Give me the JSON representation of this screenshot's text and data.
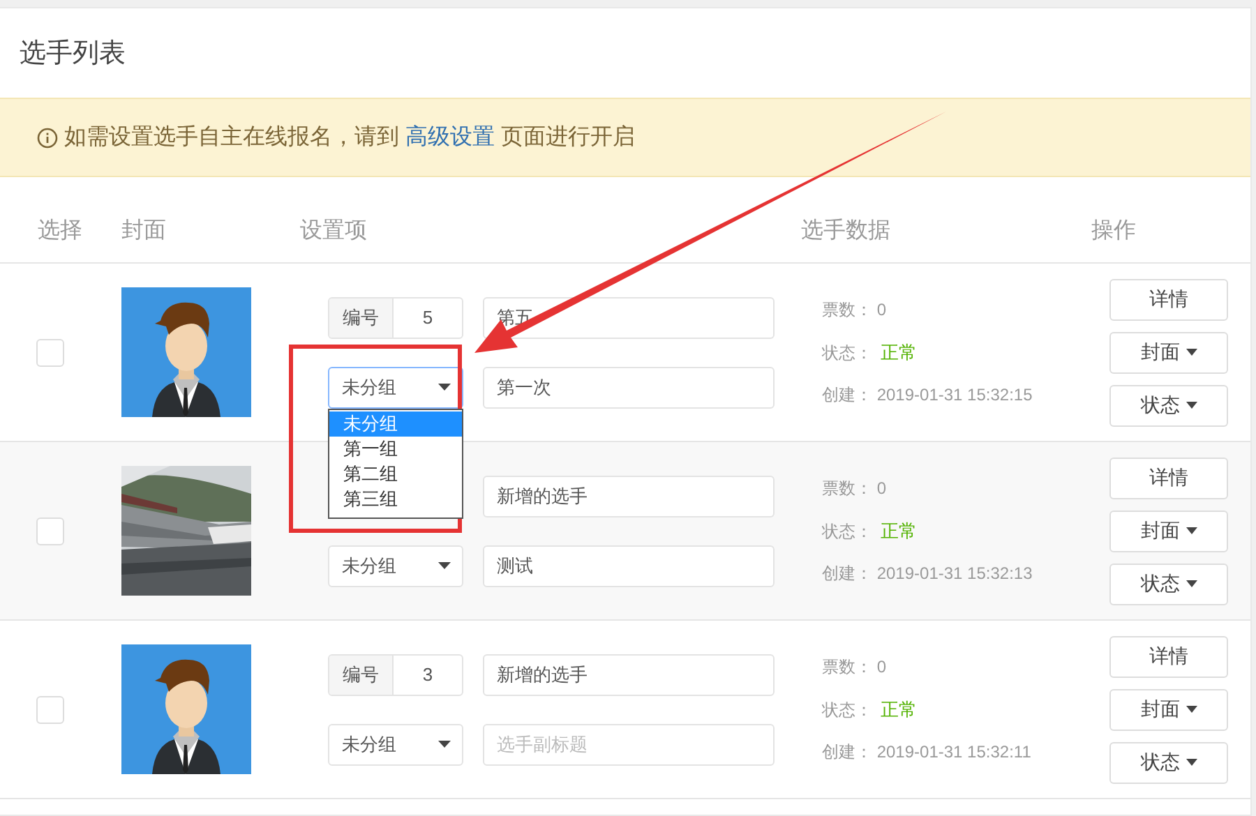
{
  "card": {
    "title": "选手列表"
  },
  "notice": {
    "text_before": "如需设置选手自主在线报名，请到",
    "link": "高级设置",
    "text_after": "页面进行开启"
  },
  "columns": [
    "选择",
    "封面",
    "设置项",
    "选手数据",
    "操作"
  ],
  "rows": [
    {
      "checked": false,
      "cover": {
        "kind": "avatar"
      },
      "number_label": "编号",
      "number": "5",
      "name": "第五",
      "group": {
        "value": "未分组",
        "expanded": true,
        "options": [
          {
            "label": "未分组",
            "selected": true
          },
          {
            "label": "第一组",
            "selected": false
          },
          {
            "label": "第二组",
            "selected": false
          },
          {
            "label": "第三组",
            "selected": false
          }
        ]
      },
      "subtitle": {
        "value": "第一次"
      },
      "votes_label": "票数：",
      "votes": "0",
      "status_label": "状态：",
      "status": "正常",
      "created_label": "创建：",
      "created": "2019-01-31 15:32:15",
      "actions": [
        {
          "label": "详情",
          "dropdown": false
        },
        {
          "label": "封面",
          "dropdown": true
        },
        {
          "label": "状态",
          "dropdown": true
        }
      ]
    },
    {
      "checked": false,
      "cover": {
        "kind": "picture"
      },
      "name": "新增的选手",
      "group": {
        "value": "未分组",
        "expanded": false
      },
      "subtitle": {
        "value": "测试"
      },
      "votes_label": "票数：",
      "votes": "0",
      "status_label": "状态：",
      "status": "正常",
      "created_label": "创建：",
      "created": "2019-01-31 15:32:13",
      "actions": [
        {
          "label": "详情",
          "dropdown": false
        },
        {
          "label": "封面",
          "dropdown": true
        },
        {
          "label": "状态",
          "dropdown": true
        }
      ]
    },
    {
      "checked": false,
      "cover": {
        "kind": "avatar"
      },
      "number_label": "编号",
      "number": "3",
      "name": "新增的选手",
      "group": {
        "value": "未分组",
        "expanded": false
      },
      "subtitle": {
        "placeholder": "选手副标题"
      },
      "votes_label": "票数：",
      "votes": "0",
      "status_label": "状态：",
      "status": "正常",
      "created_label": "创建：",
      "created": "2019-01-31 15:32:11",
      "actions": [
        {
          "label": "详情",
          "dropdown": false
        },
        {
          "label": "封面",
          "dropdown": true
        },
        {
          "label": "状态",
          "dropdown": true
        }
      ]
    }
  ]
}
